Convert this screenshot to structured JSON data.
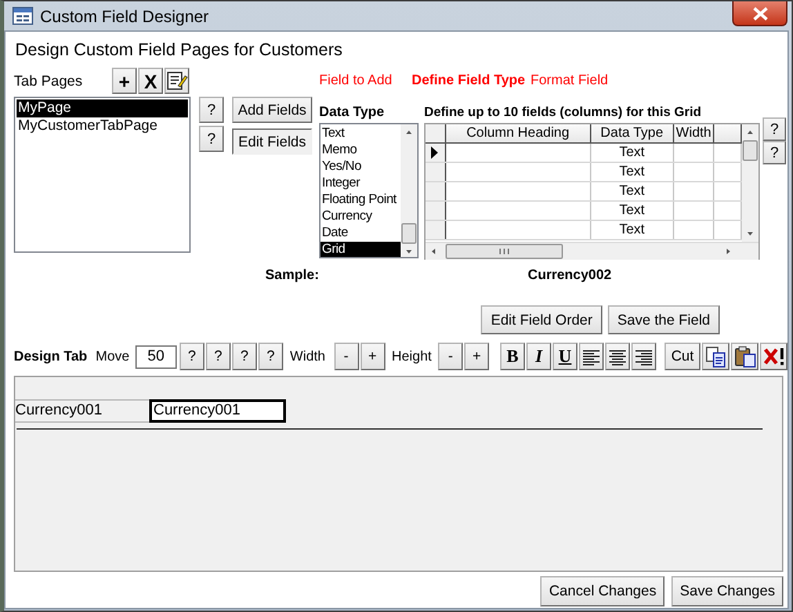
{
  "window": {
    "title": "Custom Field Designer"
  },
  "heading": "Design Custom Field Pages for Customers",
  "tab_pages": {
    "label": "Tab Pages",
    "tools": [
      {
        "kind": "add",
        "label": "+"
      },
      {
        "kind": "remove",
        "label": "X"
      },
      {
        "kind": "rename"
      }
    ],
    "items": [
      {
        "label": "MyPage",
        "selected": true
      },
      {
        "label": "MyCustomerTabPage",
        "selected": false
      }
    ],
    "help_buttons": [
      "?",
      "?"
    ]
  },
  "actions": [
    {
      "label": "Add Fields",
      "selected": false
    },
    {
      "label": "Edit Fields",
      "selected": true
    }
  ],
  "steps": [
    {
      "label": "Field to Add",
      "selected": false
    },
    {
      "label": "Define Field Type",
      "selected": true
    },
    {
      "label": "Format Field",
      "selected": false
    }
  ],
  "data_type": {
    "label": "Data Type",
    "items": [
      {
        "label": "Text",
        "selected": false
      },
      {
        "label": "Memo",
        "selected": false
      },
      {
        "label": "Yes/No",
        "selected": false
      },
      {
        "label": "Integer",
        "selected": false
      },
      {
        "label": "Floating Point",
        "selected": false
      },
      {
        "label": "Currency",
        "selected": false
      },
      {
        "label": "Date",
        "selected": false
      },
      {
        "label": "Grid",
        "selected": true
      }
    ]
  },
  "grid": {
    "label": "Define up to 10 fields (columns) for this Grid",
    "columns": [
      "Column Heading",
      "Data Type",
      "Width"
    ],
    "rows": [
      {
        "current": true,
        "data_type": "Text"
      },
      {
        "current": false,
        "data_type": "Text"
      },
      {
        "current": false,
        "data_type": "Text"
      },
      {
        "current": false,
        "data_type": "Text"
      },
      {
        "current": false,
        "data_type": "Text"
      }
    ],
    "help_buttons": [
      "?",
      "?"
    ]
  },
  "sample": {
    "label": "Sample:",
    "value": "Currency002"
  },
  "field_buttons": [
    "Edit Field Order",
    "Save the Field"
  ],
  "design_toolbar": {
    "label": "Design Tab",
    "move_label": "Move",
    "move_value": "50",
    "move_buttons": [
      "?",
      "?",
      "?",
      "?"
    ],
    "width_label": "Width",
    "width_buttons": [
      "-",
      "+"
    ],
    "height_label": "Height",
    "height_buttons": [
      "-",
      "+"
    ],
    "format_buttons": [
      {
        "kind": "bold",
        "label": "B"
      },
      {
        "kind": "italic",
        "label": "I"
      },
      {
        "kind": "underline",
        "label": "U"
      },
      {
        "kind": "align-left"
      },
      {
        "kind": "align-center"
      },
      {
        "kind": "align-right"
      },
      {
        "kind": "cut",
        "label": "Cut"
      },
      {
        "kind": "copy"
      },
      {
        "kind": "paste"
      },
      {
        "kind": "delete"
      }
    ]
  },
  "canvas": {
    "fields": [
      {
        "label": "Currency001",
        "value": "Currency001"
      }
    ]
  },
  "footer_buttons": [
    "Cancel Changes",
    "Save Changes"
  ]
}
